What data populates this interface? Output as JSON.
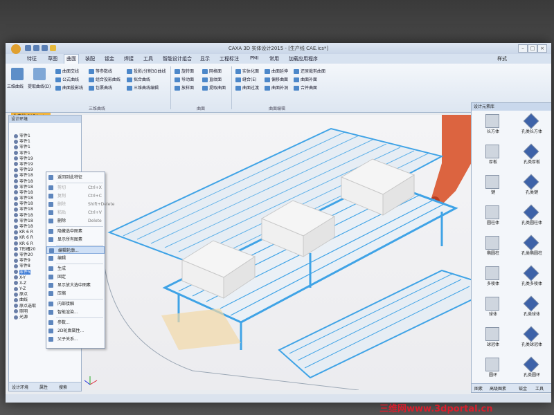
{
  "window": {
    "title": "CAXA 3D 实体设计2015 - [生产线 CAE.ics*]",
    "style_label": "样式"
  },
  "menu_tabs": [
    "特征",
    "草图",
    "曲面",
    "装配",
    "钣金",
    "焊接",
    "工具",
    "智能设计组合",
    "显示",
    "工程标注",
    "PMI",
    "常用",
    "加载应用程序"
  ],
  "active_tab_index": 2,
  "ribbon": {
    "big_buttons": [
      "三维曲线",
      "提取曲线(D)"
    ],
    "col1": [
      "曲面交线",
      "公式曲线",
      "曲面投影线"
    ],
    "col2": [
      "等参数线",
      "组合投影曲线",
      "包裹曲线"
    ],
    "col3": [
      "投影/分割3D曲线",
      "拟合曲线",
      "三维曲线编辑"
    ],
    "col4": [
      "旋转面",
      "导动面",
      "放样面"
    ],
    "col5": [
      "网格面",
      "直纹面",
      "提取曲面"
    ],
    "col6": [
      "实体化面",
      "缝合(E)",
      "曲面过渡"
    ],
    "col7": [
      "曲面延伸",
      "偏移曲面",
      "曲面补洞"
    ],
    "col8": [
      "还原裁剪曲面",
      "曲面补面",
      "合并曲面"
    ],
    "groups": [
      "三维曲线",
      "曲面",
      "曲面编辑"
    ]
  },
  "document_tab": "生产线 CAE.ics*",
  "left_panel": {
    "title": "设计环境",
    "tree": [
      "零件1",
      "零件1",
      "零件1",
      "零件1",
      "零件19",
      "零件19",
      "零件19",
      "零件18",
      "零件18",
      "零件18",
      "零件18",
      "零件18",
      "零件18",
      "零件18",
      "零件18",
      "零件18",
      "零件18",
      "KR 6 R",
      "KR 6 R",
      "KR 6 R",
      "T形槽20",
      "零件20",
      "零件9",
      "零件8",
      "零件5",
      "X-Y",
      "X-Z",
      "Y-Z",
      "原点",
      "曲线",
      "原点选取",
      "照明",
      "光源"
    ],
    "selected_index": 24,
    "bottom_tabs": [
      "设计环境",
      "属性",
      "搜索"
    ]
  },
  "context_menu": {
    "items": [
      {
        "label": "返回到此特征",
        "shortcut": "",
        "disabled": false
      },
      {
        "label": "剪切",
        "shortcut": "Ctrl+X",
        "disabled": true
      },
      {
        "label": "复制",
        "shortcut": "Ctrl+C",
        "disabled": true
      },
      {
        "label": "删除",
        "shortcut": "Shift+Delete",
        "disabled": true
      },
      {
        "label": "粘贴",
        "shortcut": "Ctrl+V",
        "disabled": true
      },
      {
        "label": "删除",
        "shortcut": "Delete",
        "disabled": false
      },
      {
        "label": "隐藏选中图素",
        "shortcut": "",
        "disabled": false
      },
      {
        "label": "显示所有图素",
        "shortcut": "",
        "disabled": false
      },
      {
        "label": "编辑轮廓...",
        "shortcut": "",
        "disabled": false
      },
      {
        "label": "编辑",
        "shortcut": "",
        "disabled": false
      },
      {
        "label": "生成",
        "shortcut": "",
        "disabled": false
      },
      {
        "label": "固定",
        "shortcut": "",
        "disabled": false
      },
      {
        "label": "显示放大选中图素",
        "shortcut": "",
        "disabled": false
      },
      {
        "label": "压缩",
        "shortcut": "",
        "disabled": false
      },
      {
        "label": "内部接触",
        "shortcut": "",
        "disabled": false
      },
      {
        "label": "智能渲染...",
        "shortcut": "",
        "disabled": false
      },
      {
        "label": "参数...",
        "shortcut": "",
        "disabled": false
      },
      {
        "label": "2D轮廓属性...",
        "shortcut": "",
        "disabled": false
      },
      {
        "label": "父子关系...",
        "shortcut": "",
        "disabled": false
      }
    ],
    "highlight_index": 8
  },
  "right_panel": {
    "title": "设计元素库",
    "items": [
      "长方体",
      "孔类长方体",
      "厚板",
      "孔类厚板",
      "键",
      "孔类键",
      "圆柱体",
      "孔类圆柱体",
      "椭圆柱",
      "孔类椭圆柱",
      "多棱体",
      "孔类多棱体",
      "球体",
      "孔类球体",
      "球冠体",
      "孔类球冠体",
      "圆环",
      "孔类圆环"
    ],
    "bottom_tabs": [
      "图素",
      "高级图素",
      "钣金",
      "工具"
    ]
  },
  "watermark": "三维网www.3dportal.cn",
  "colors": {
    "conveyor": "#3fa3e6",
    "box": "#f3f3f3",
    "robot": "#d9542c",
    "highlight": "#cfe0f6"
  }
}
